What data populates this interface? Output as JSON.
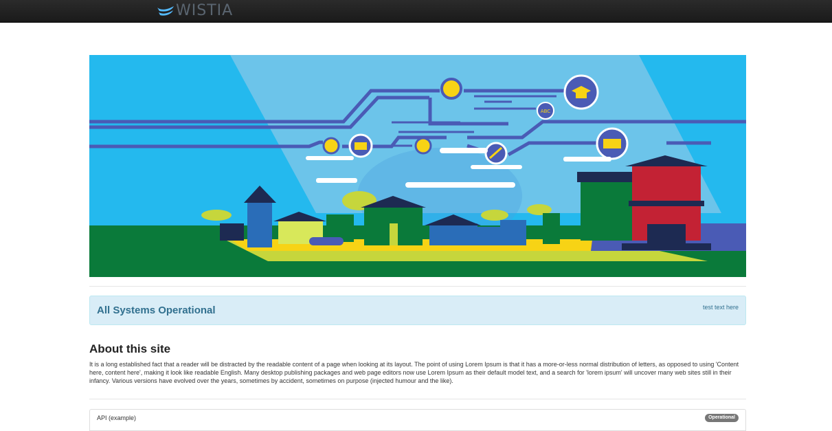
{
  "header": {
    "logo_text": "WISTIA",
    "logo_color": "#54bbff"
  },
  "banner": {
    "title": "All Systems Operational",
    "link": "test text here"
  },
  "about": {
    "title": "About this site",
    "body": "It is a long established fact that a reader will be distracted by the readable content of a page when looking at its layout. The point of using Lorem Ipsum is that it has a more-or-less normal distribution of letters, as opposed to using 'Content here, content here', making it look like readable English. Many desktop publishing packages and web page editors now use Lorem Ipsum as their default model text, and a search for 'lorem ipsum' will uncover many web sites still in their infancy. Various versions have evolved over the years, sometimes by accident, sometimes on purpose (injected humour and the like)."
  },
  "components": [
    {
      "name": "API (example)",
      "status": "Operational"
    }
  ],
  "hero_icons": [
    "globe-icon",
    "graduation-cap-icon",
    "abc-icon",
    "book-icon",
    "briefcase-icon",
    "calculator-icon",
    "pencil-icon",
    "bookshelf-icon"
  ],
  "colors": {
    "sky": "#24b9ee",
    "grass": "#0a7a3a",
    "road": "#f7d315",
    "circuit": "#4a5bb5",
    "banner_bg": "#d9edf7",
    "banner_text": "#31708f",
    "badge": "#777777"
  }
}
